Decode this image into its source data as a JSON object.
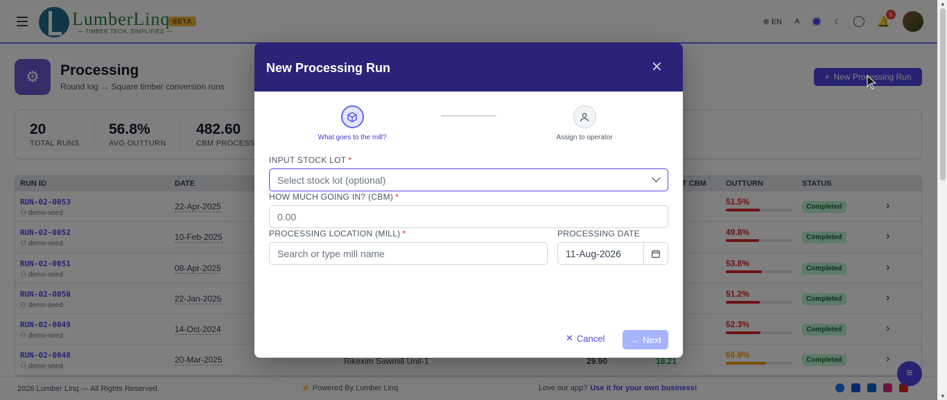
{
  "header": {
    "logo_name": "LumberLinq",
    "logo_tagline": "— TIMBER TECH, SIMPLIFIED —",
    "beta_label": "BETA",
    "language": "EN",
    "font_toggle": "A",
    "notification_count": "6"
  },
  "page": {
    "title": "Processing",
    "subtitle": "Round log → Square timber conversion runs",
    "new_button_label": "New Processing Run"
  },
  "stats": [
    {
      "value": "20",
      "label": "TOTAL RUNS"
    },
    {
      "value": "56.8%",
      "label": "AVG OUTTURN"
    },
    {
      "value": "482.60",
      "label": "CBM PROCESS"
    }
  ],
  "table": {
    "columns": [
      "RUN ID",
      "DATE",
      "T CBM",
      "OUTTURN",
      "STATUS"
    ],
    "rows": [
      {
        "id": "RUN-02-0053",
        "by": "demo-seed",
        "date": "22-Apr-2025",
        "mill": "",
        "in": "",
        "out": "",
        "outturn": "51.5%",
        "pct": 51.5,
        "status": "Completed"
      },
      {
        "id": "RUN-02-0052",
        "by": "demo-seed",
        "date": "10-Feb-2025",
        "mill": "",
        "in": "",
        "out": "",
        "outturn": "49.8%",
        "pct": 49.8,
        "status": "Completed"
      },
      {
        "id": "RUN-02-0051",
        "by": "demo-seed",
        "date": "08-Apr-2025",
        "mill": "",
        "in": "",
        "out": "",
        "outturn": "53.8%",
        "pct": 53.8,
        "status": "Completed"
      },
      {
        "id": "RUN-02-0050",
        "by": "demo-seed",
        "date": "22-Jan-2025",
        "mill": "",
        "in": "",
        "out": "",
        "outturn": "51.2%",
        "pct": 51.2,
        "status": "Completed"
      },
      {
        "id": "RUN-02-0049",
        "by": "demo-seed",
        "date": "14-Oct-2024",
        "mill": "",
        "in": "",
        "out": "",
        "outturn": "52.3%",
        "pct": 52.3,
        "status": "Completed"
      },
      {
        "id": "RUN-02-0048",
        "by": "demo-seed",
        "date": "20-Mar-2025",
        "mill": "Rikexim Sawmill Unit-1",
        "in": "29.90",
        "out": "18.21",
        "outturn": "60.9%",
        "pct": 60.9,
        "status": "Completed"
      }
    ]
  },
  "footer": {
    "copyright": "2026 Lumber Linq — All Rights Reserved.",
    "powered": "Powered By Lumber Linq",
    "love": "Love our app?",
    "cta": "Use it for your own business!"
  },
  "modal": {
    "title": "New Processing Run",
    "steps": [
      {
        "label": "What goes to the mill?"
      },
      {
        "label": "Assign to operator"
      }
    ],
    "stock_lot": {
      "label": "INPUT STOCK LOT",
      "placeholder": "Select stock lot (optional)"
    },
    "volume": {
      "label": "HOW MUCH GOING IN? (CBM)",
      "placeholder": "0.00"
    },
    "location": {
      "label": "PROCESSING LOCATION (MILL)",
      "placeholder": "Search or type mill name"
    },
    "date": {
      "label": "PROCESSING DATE",
      "value": "11-Aug-2026"
    },
    "cancel_label": "Cancel",
    "next_label": "Next"
  },
  "colors": {
    "accent": "#4f46e5",
    "modal_header": "#2a2478",
    "success": "#16a34a",
    "danger": "#dc2626",
    "warning": "#f59e0b"
  }
}
